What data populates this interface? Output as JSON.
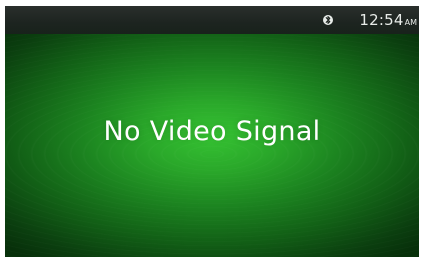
{
  "status_bar": {
    "bluetooth_icon": "bluetooth-icon",
    "time": "12:54",
    "ampm": "AM"
  },
  "screen": {
    "message": "No Video Signal",
    "background_color": "#2aa82a"
  }
}
